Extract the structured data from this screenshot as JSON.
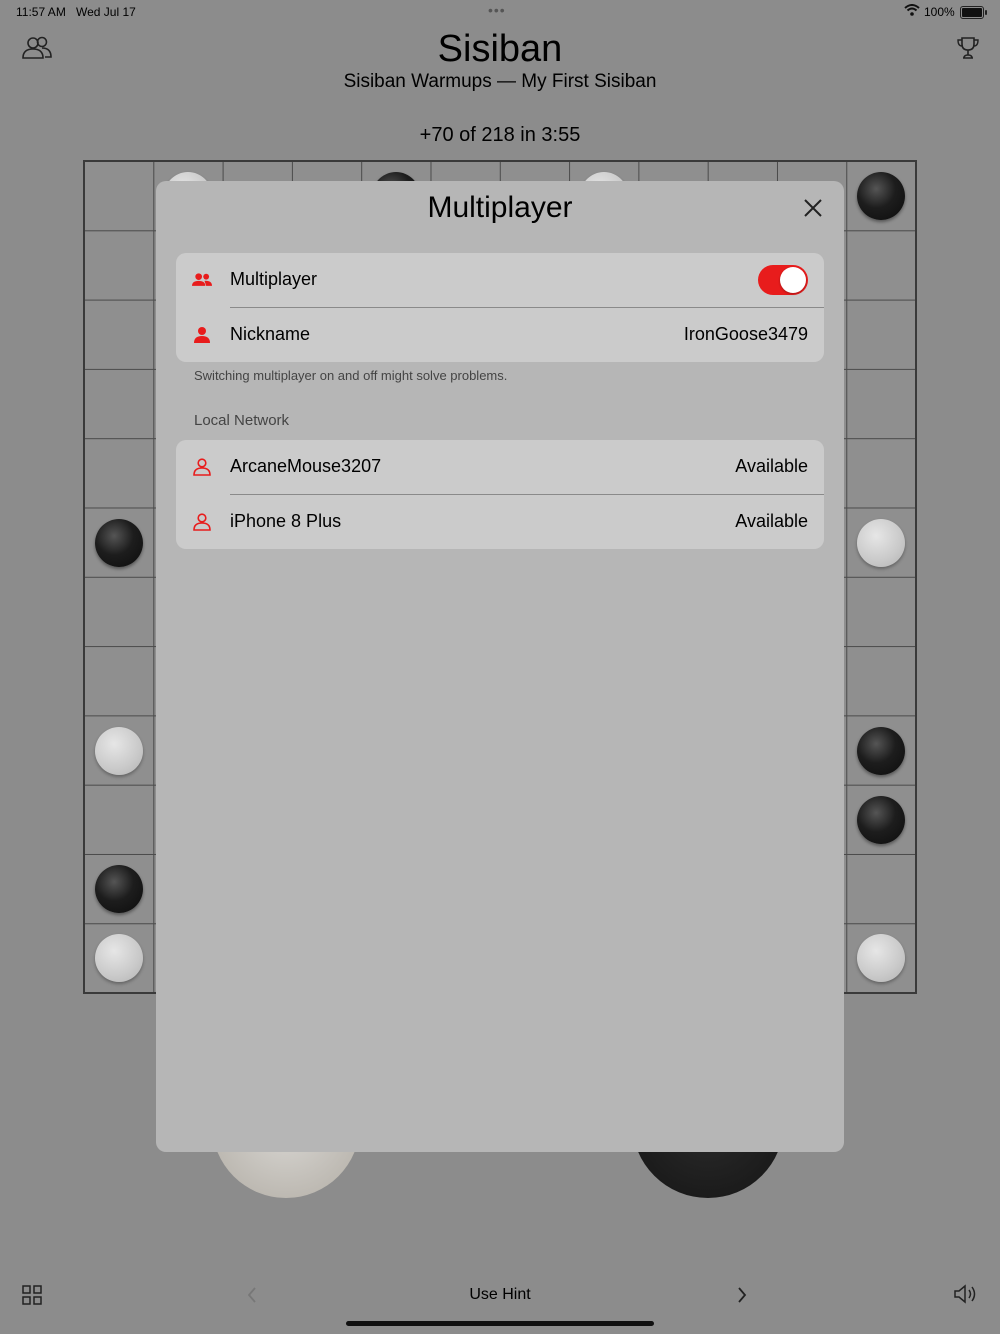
{
  "status_bar": {
    "time": "11:57 AM",
    "date": "Wed Jul 17",
    "battery": "100%"
  },
  "header": {
    "title": "Sisiban",
    "subtitle": "Sisiban Warmups — My First Sisiban",
    "score": "+70 of 218 in 3:55",
    "left_icon": "people-icon",
    "right_icon": "trophy-icon"
  },
  "modal": {
    "title": "Multiplayer",
    "settings": {
      "multiplayer_label": "Multiplayer",
      "multiplayer_enabled": true,
      "nickname_label": "Nickname",
      "nickname_value": "IronGoose3479"
    },
    "footnote": "Switching multiplayer on and off might solve problems.",
    "local_network": {
      "header": "Local Network",
      "peers": [
        {
          "name": "ArcaneMouse3207",
          "status": "Available"
        },
        {
          "name": "iPhone 8 Plus",
          "status": "Available"
        }
      ]
    }
  },
  "toolbar": {
    "hint_label": "Use Hint"
  },
  "colors": {
    "accent": "#e81c1c",
    "dim_background": "#8c8c8c",
    "modal_background": "#b6b6b6",
    "group_background": "#cbcbcb"
  }
}
